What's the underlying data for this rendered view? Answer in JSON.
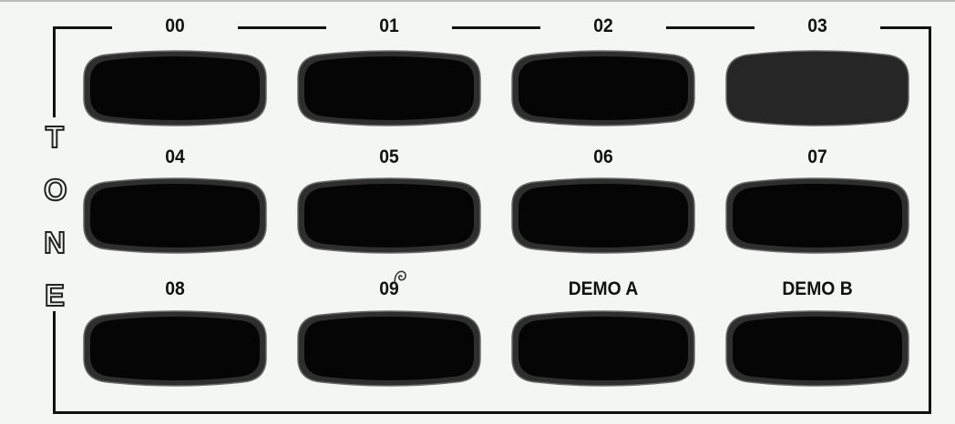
{
  "panel": {
    "side_label": [
      "T",
      "O",
      "N",
      "E"
    ],
    "pads": [
      {
        "label": "00",
        "active": false
      },
      {
        "label": "01",
        "active": false
      },
      {
        "label": "02",
        "active": false
      },
      {
        "label": "03",
        "active": true
      },
      {
        "label": "04",
        "active": false
      },
      {
        "label": "05",
        "active": false
      },
      {
        "label": "06",
        "active": false
      },
      {
        "label": "07",
        "active": false
      },
      {
        "label": "08",
        "active": false
      },
      {
        "label": "09",
        "active": false
      },
      {
        "label": "DEMO A",
        "active": false
      },
      {
        "label": "DEMO B",
        "active": false
      }
    ]
  },
  "colors": {
    "background": "#f4f6f3",
    "pad_fill": "#050505",
    "pad_active_fill": "#262626",
    "pad_rim": "#2e2e2e",
    "pad_edge": "#6a6a6a",
    "frame": "#111111"
  }
}
